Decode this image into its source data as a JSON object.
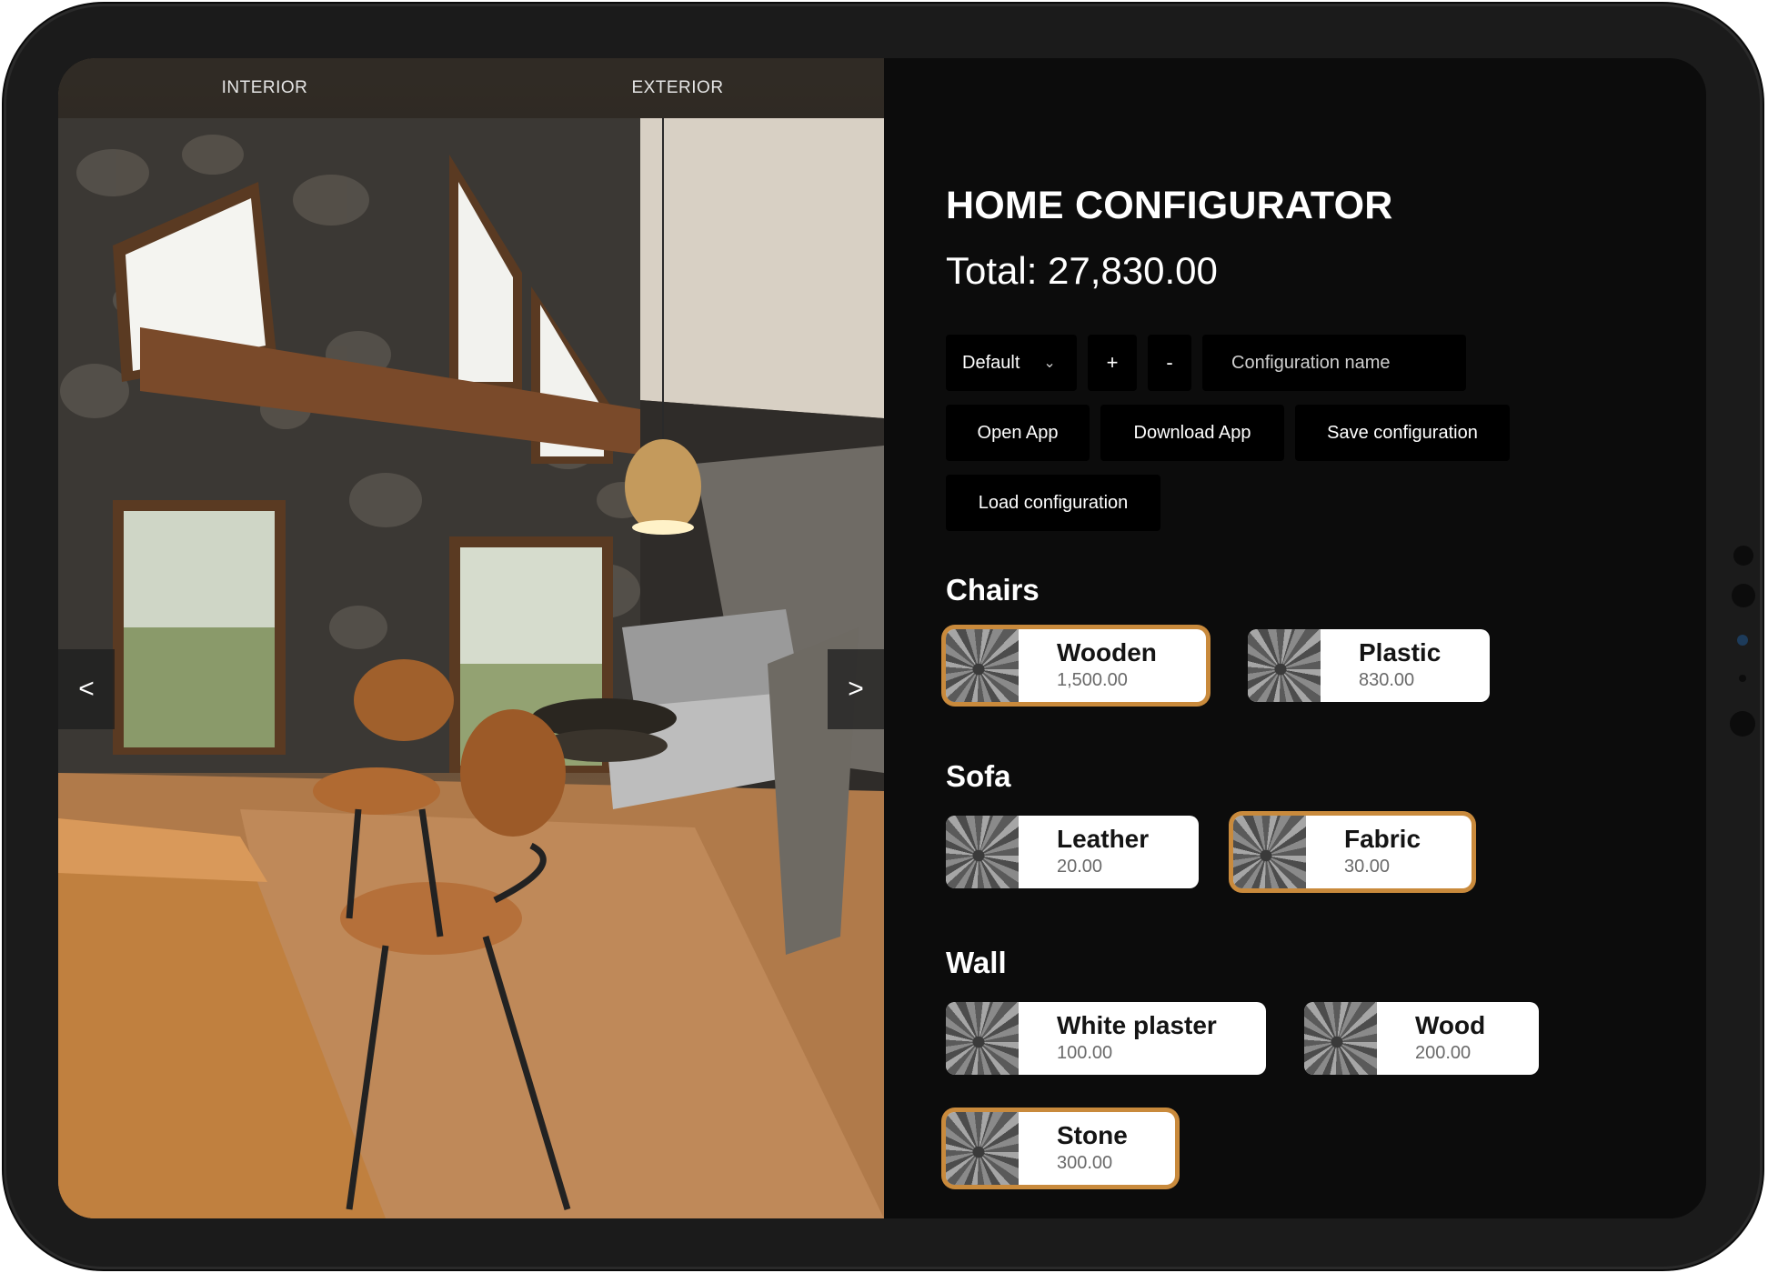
{
  "viewer": {
    "tabs": [
      {
        "label": "INTERIOR"
      },
      {
        "label": "EXTERIOR"
      }
    ],
    "prev_label": "<",
    "next_label": ">"
  },
  "header": {
    "title": "HOME CONFIGURATOR",
    "total": "Total: 27,830.00"
  },
  "controls": {
    "preset_select": "Default",
    "add_label": "+",
    "remove_label": "-",
    "config_name_placeholder": "Configuration name",
    "open_app": "Open App",
    "download_app": "Download App",
    "save_configuration": "Save configuration",
    "load_configuration": "Load configuration"
  },
  "sections": {
    "chairs": {
      "title": "Chairs",
      "options": [
        {
          "name": "Wooden",
          "price": "1,500.00",
          "selected": true
        },
        {
          "name": "Plastic",
          "price": "830.00",
          "selected": false
        }
      ]
    },
    "sofa": {
      "title": "Sofa",
      "options": [
        {
          "name": "Leather",
          "price": "20.00",
          "selected": false
        },
        {
          "name": "Fabric",
          "price": "30.00",
          "selected": true
        }
      ]
    },
    "wall": {
      "title": "Wall",
      "options": [
        {
          "name": "White plaster",
          "price": "100.00",
          "selected": false
        },
        {
          "name": "Wood",
          "price": "200.00",
          "selected": false
        },
        {
          "name": "Stone",
          "price": "300.00",
          "selected": true
        }
      ]
    }
  },
  "colors": {
    "accent": "#c98a3c",
    "panel_bg": "#0c0c0c",
    "button_bg": "#000000"
  }
}
